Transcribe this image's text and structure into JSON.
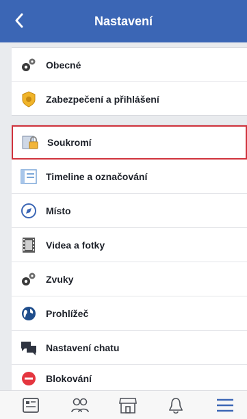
{
  "navbar": {
    "title": "Nastavení"
  },
  "groups": [
    {
      "items": [
        {
          "label": "Obecné",
          "icon": "gears-icon"
        },
        {
          "label": "Zabezpečení a přihlášení",
          "icon": "security-badge-icon"
        }
      ]
    },
    {
      "items": [
        {
          "label": "Soukromí",
          "icon": "privacy-lock-icon",
          "selected": true
        },
        {
          "label": "Timeline a označování",
          "icon": "timeline-icon"
        },
        {
          "label": "Místo",
          "icon": "compass-icon"
        },
        {
          "label": "Videa a fotky",
          "icon": "film-icon"
        },
        {
          "label": "Zvuky",
          "icon": "gears-icon"
        },
        {
          "label": "Prohlížeč",
          "icon": "globe-icon"
        },
        {
          "label": "Nastavení chatu",
          "icon": "chat-bubbles-icon"
        },
        {
          "label": "Blokování",
          "icon": "block-icon"
        }
      ]
    }
  ],
  "tabbar": {
    "tabs": [
      "news-feed-icon",
      "friends-icon",
      "marketplace-icon",
      "notifications-icon",
      "menu-icon"
    ],
    "active_color": "#3b66b5"
  }
}
